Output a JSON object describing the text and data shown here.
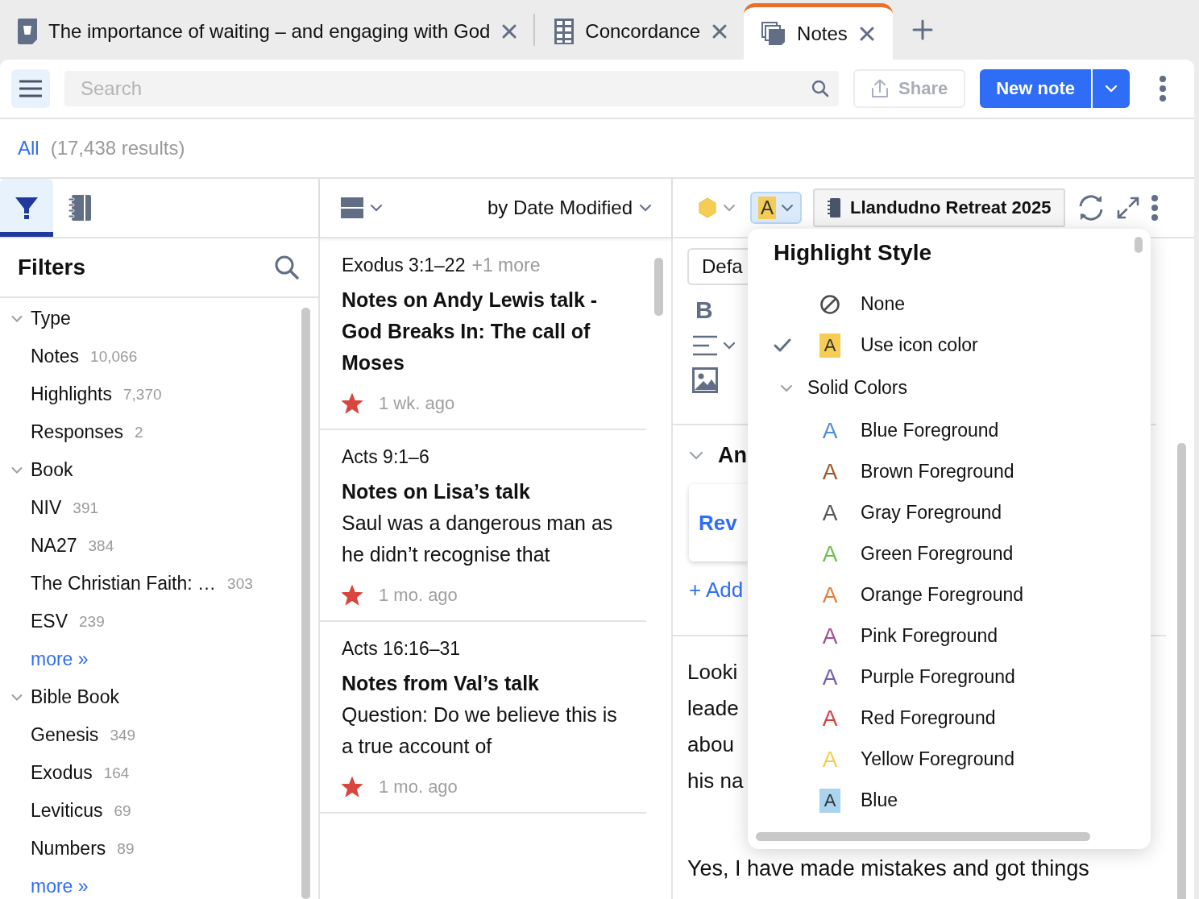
{
  "tabs": [
    {
      "title": "The importance of waiting – and engaging with God",
      "selected": false
    },
    {
      "title": "Concordance",
      "selected": false
    },
    {
      "title": "Notes",
      "selected": true
    }
  ],
  "toolbar": {
    "search": {
      "placeholder": "Search"
    },
    "share_button": "Share",
    "new_note_button": "New note"
  },
  "scope": {
    "label": "All",
    "count": "(17,438 results)"
  },
  "left_panel": {
    "tabs": [
      {
        "selected": true
      },
      {
        "selected": false
      }
    ],
    "title": "Filters",
    "groups": [
      {
        "label": "Type",
        "expanded": true,
        "children": [
          {
            "label": "Notes",
            "count": "10,066"
          },
          {
            "label": "Highlights",
            "count": "7,370"
          },
          {
            "label": "Responses",
            "count": "2"
          }
        ]
      },
      {
        "label": "Book",
        "expanded": true,
        "children": [
          {
            "label": "NIV",
            "count": "391"
          },
          {
            "label": "NA27",
            "count": "384"
          },
          {
            "label": "The Christian Faith: …",
            "count": "303"
          },
          {
            "label": "ESV",
            "count": "239"
          }
        ],
        "more": "more »"
      },
      {
        "label": "Bible Book",
        "expanded": true,
        "children": [
          {
            "label": "Genesis",
            "count": "349"
          },
          {
            "label": "Exodus",
            "count": "164"
          },
          {
            "label": "Leviticus",
            "count": "69"
          },
          {
            "label": "Numbers",
            "count": "89"
          }
        ],
        "more": "more »"
      }
    ]
  },
  "notes_list": {
    "sort": "by Date Modified",
    "notes": [
      {
        "reference": "Exodus 3:1–22",
        "extra": "+1 more",
        "title": "Notes on Andy Lewis talk - God Breaks In: The call of Moses",
        "starred": true,
        "time": "1 wk. ago"
      },
      {
        "reference": "Acts 9:1–6",
        "title": "Notes on Lisa’s talk",
        "body": "Saul was a dangerous man as he didn’t recognise that",
        "starred": true,
        "time": "1 mo. ago"
      },
      {
        "reference": "Acts 16:16–31",
        "title": "Notes from Val’s talk",
        "body": "Question: Do we believe this is a true account of",
        "starred": true,
        "time": "1 mo. ago"
      }
    ]
  },
  "editor": {
    "highlight_glyph": "A",
    "notebook": "Llandudno Retreat 2025",
    "style_field": "Defa",
    "bold": "B",
    "section_heading": "An",
    "card_link": "Rev",
    "add_link": "+ Add",
    "paragraph_lines": [
      "Looki",
      "leade",
      "abou",
      "his na"
    ],
    "next_line": "Yes, I have made mistakes and got things"
  },
  "highlight_menu": {
    "title": "Highlight Style",
    "items": [
      {
        "kind": "none",
        "label": "None",
        "selected": false
      },
      {
        "kind": "swatch",
        "glyph": "A",
        "color": "#f5cd55",
        "label": "Use icon color",
        "selected": true
      },
      {
        "kind": "group",
        "label": "Solid Colors",
        "expanded": true,
        "children": [
          {
            "kind": "foreground",
            "glyph": "A",
            "color": "#4a90d9",
            "label": "Blue Foreground",
            "selected": false
          },
          {
            "kind": "foreground",
            "glyph": "A",
            "color": "#a0562c",
            "label": "Brown Foreground",
            "selected": false
          },
          {
            "kind": "foreground",
            "glyph": "A",
            "color": "#555555",
            "label": "Gray Foreground",
            "selected": false
          },
          {
            "kind": "foreground",
            "glyph": "A",
            "color": "#6abf4b",
            "label": "Green Foreground",
            "selected": false
          },
          {
            "kind": "foreground",
            "glyph": "A",
            "color": "#e0813a",
            "label": "Orange Foreground",
            "selected": false
          },
          {
            "kind": "foreground",
            "glyph": "A",
            "color": "#a0509a",
            "label": "Pink Foreground",
            "selected": false
          },
          {
            "kind": "foreground",
            "glyph": "A",
            "color": "#7a5bb5",
            "label": "Purple Foreground",
            "selected": false
          },
          {
            "kind": "foreground",
            "glyph": "A",
            "color": "#d94040",
            "label": "Red Foreground",
            "selected": false
          },
          {
            "kind": "foreground",
            "glyph": "A",
            "color": "#f5cd55",
            "label": "Yellow Foreground",
            "selected": false
          },
          {
            "kind": "swatch",
            "glyph": "A",
            "color": "#a8d4f0",
            "label": "Blue",
            "selected": false
          }
        ]
      }
    ]
  }
}
